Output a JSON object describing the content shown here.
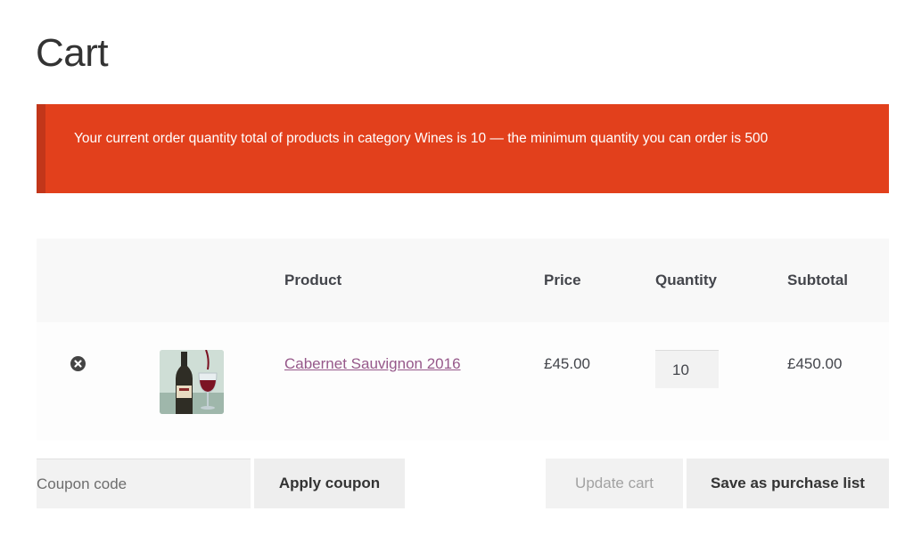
{
  "page": {
    "title": "Cart"
  },
  "notice": {
    "message": "Your current order quantity total of products in category Wines is 10 — the minimum quantity you can order is 500",
    "color": "#e2401c"
  },
  "cart": {
    "headers": {
      "product": "Product",
      "price": "Price",
      "quantity": "Quantity",
      "subtotal": "Subtotal"
    },
    "items": [
      {
        "remove_icon": "remove-circle-x-icon",
        "thumbnail": "wine-bottle-and-glass",
        "name": "Cabernet Sauvignon 2016",
        "price": "£45.00",
        "quantity": "10",
        "subtotal": "£450.00"
      }
    ]
  },
  "actions": {
    "coupon_placeholder": "Coupon code",
    "apply_coupon": "Apply coupon",
    "update_cart": "Update cart",
    "save_purchase_list": "Save as purchase list"
  },
  "colors": {
    "link": "#96588a",
    "error": "#e2401c"
  }
}
